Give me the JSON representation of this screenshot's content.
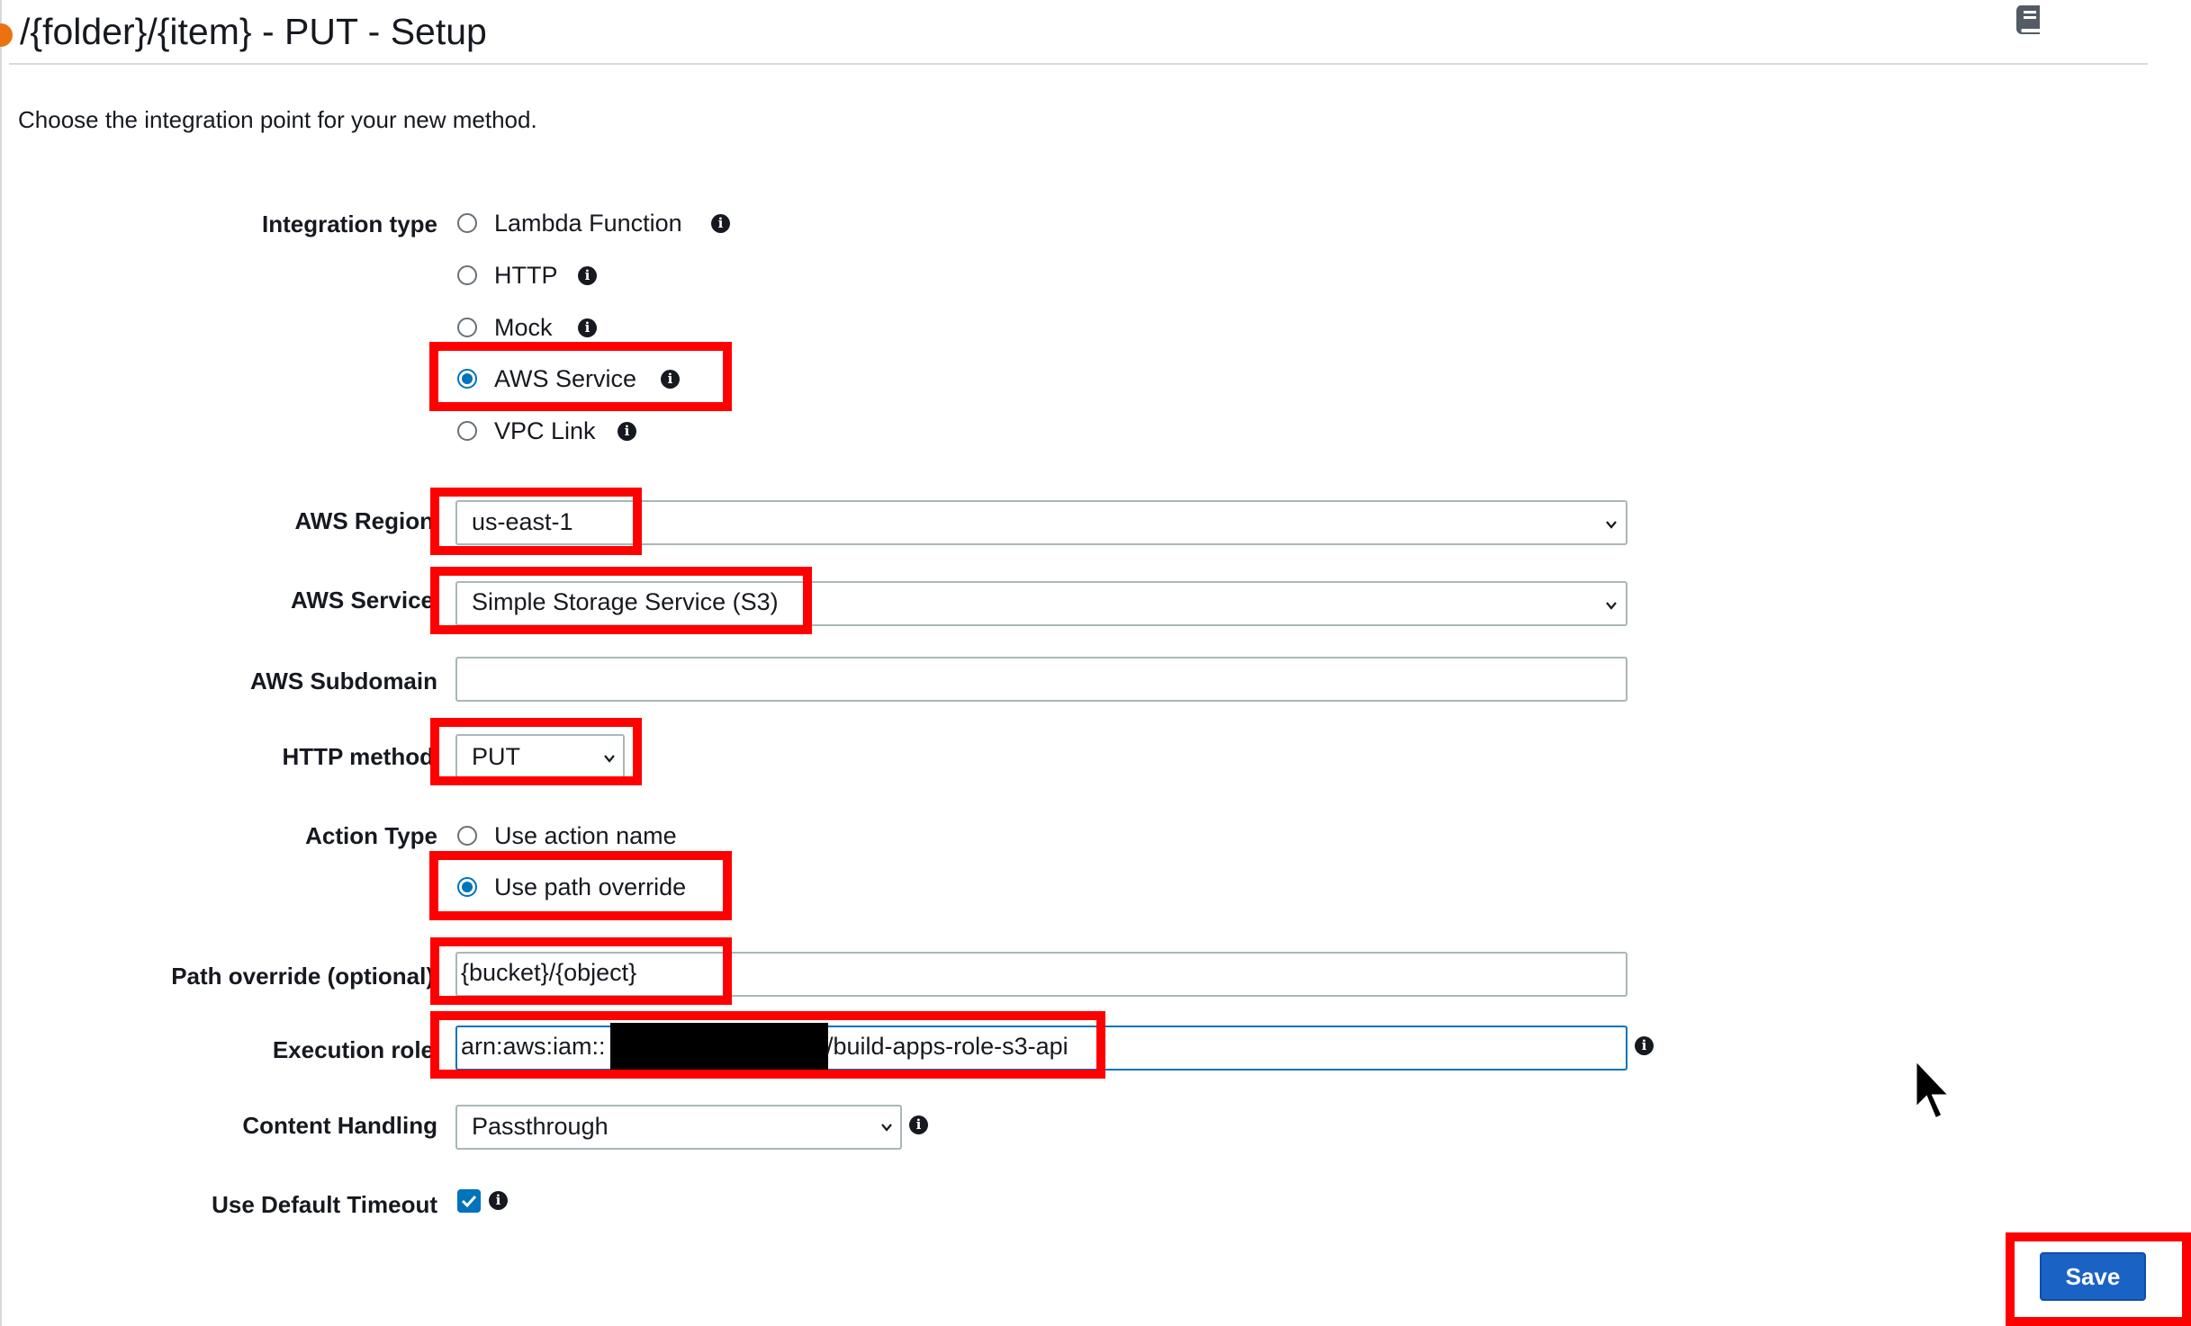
{
  "header": {
    "title": "/{folder}/{item} - PUT - Setup",
    "subtitle": "Choose the integration point for your new method."
  },
  "icons": {
    "book": "book-icon",
    "info": "info-icon",
    "cursor": "mouse-pointer-icon"
  },
  "form": {
    "integration_type": {
      "label": "Integration type",
      "options": [
        {
          "label": "Lambda Function",
          "selected": false
        },
        {
          "label": "HTTP",
          "selected": false
        },
        {
          "label": "Mock",
          "selected": false
        },
        {
          "label": "AWS Service",
          "selected": true
        },
        {
          "label": "VPC Link",
          "selected": false
        }
      ]
    },
    "aws_region": {
      "label": "AWS Region",
      "value": "us-east-1"
    },
    "aws_service": {
      "label": "AWS Service",
      "value": "Simple Storage Service (S3)"
    },
    "aws_subdomain": {
      "label": "AWS Subdomain",
      "value": ""
    },
    "http_method": {
      "label": "HTTP method",
      "value": "PUT"
    },
    "action_type": {
      "label": "Action Type",
      "options": [
        {
          "label": "Use action name",
          "selected": false
        },
        {
          "label": "Use path override",
          "selected": true
        }
      ]
    },
    "path_override": {
      "label": "Path override (optional)",
      "value": "{bucket}/{object}"
    },
    "execution_role": {
      "label": "Execution role",
      "value_prefix": "arn:aws:iam::",
      "value_suffix": "/build-apps-role-s3-api"
    },
    "content_handling": {
      "label": "Content Handling",
      "value": "Passthrough"
    },
    "default_timeout": {
      "label": "Use Default Timeout",
      "checked": true
    }
  },
  "actions": {
    "save_label": "Save"
  },
  "colors": {
    "accent": "#0073bb",
    "highlight": "#ff0000",
    "save_button": "#1a62c4",
    "title_dot": "#ec7211"
  }
}
